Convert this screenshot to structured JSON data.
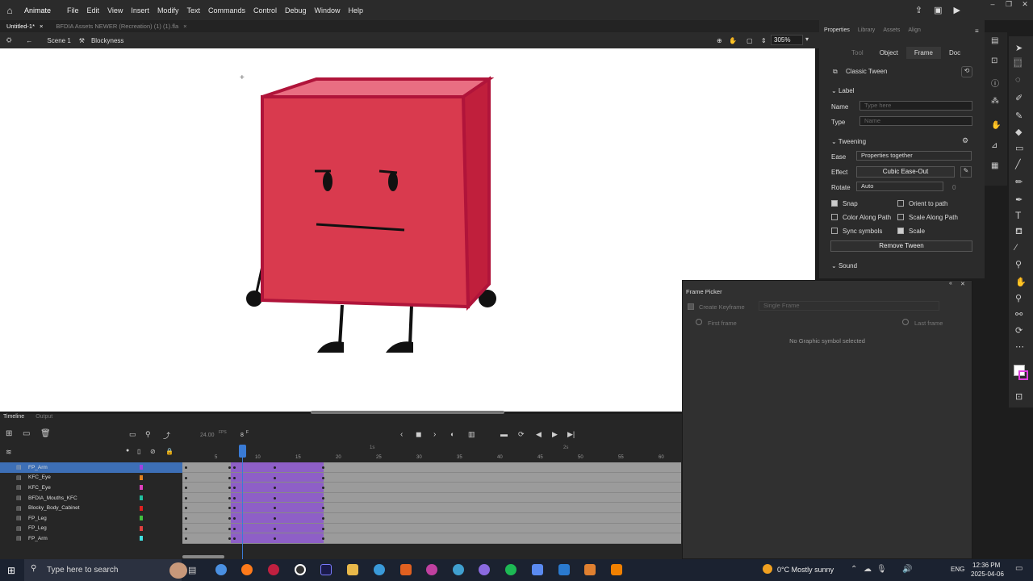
{
  "menubar": {
    "app": "Animate",
    "items": [
      "File",
      "Edit",
      "View",
      "Insert",
      "Modify",
      "Text",
      "Commands",
      "Control",
      "Debug",
      "Window",
      "Help"
    ]
  },
  "tabs": [
    {
      "label": "Untitled-1*",
      "active": true
    },
    {
      "label": "BFDIA Assets NEWER (Recreation) (1) (1).fla",
      "active": false
    }
  ],
  "scenebar": {
    "scene": "Scene 1",
    "symbol": "Blockyness",
    "zoom": "305%"
  },
  "timeline": {
    "tabs": [
      "Timeline",
      "Output"
    ],
    "fps": "24.00",
    "fps_unit": "FPS",
    "current_frame": "8",
    "frame_suffix": "F",
    "ruler": [
      "5",
      "10",
      "15",
      "20",
      "25",
      "30",
      "35",
      "40",
      "45",
      "50",
      "55",
      "60"
    ],
    "second_markers": [
      "1s",
      "2s"
    ],
    "layers": [
      {
        "name": "FP_Arm",
        "color": "#a040e0",
        "selected": true
      },
      {
        "name": "KFC_Eye",
        "color": "#e08020"
      },
      {
        "name": "KFC_Eye",
        "color": "#e040c0"
      },
      {
        "name": "BFDIA_Mouths_KFC",
        "color": "#20c0a0"
      },
      {
        "name": "Blocky_Body_Cabinet",
        "color": "#e02020"
      },
      {
        "name": "FP_Leg",
        "color": "#40c040"
      },
      {
        "name": "FP_Leg",
        "color": "#e04040"
      },
      {
        "name": "FP_Arm",
        "color": "#40e0e0"
      }
    ]
  },
  "properties": {
    "tabs": [
      "Properties",
      "Library",
      "Assets",
      "Align"
    ],
    "subtabs": [
      "Tool",
      "Object",
      "Frame",
      "Doc"
    ],
    "tween_type": "Classic Tween",
    "label_section": "Label",
    "name_label": "Name",
    "name_placeholder": "Type here",
    "type_label": "Type",
    "type_value": "Name",
    "tweening_section": "Tweening",
    "ease_label": "Ease",
    "ease_value": "Properties together",
    "effect_label": "Effect",
    "effect_value": "Cubic Ease-Out",
    "rotate_label": "Rotate",
    "rotate_value": "Auto",
    "rotate_count": "0",
    "snap": "Snap",
    "orient": "Orient to path",
    "color_path": "Color Along Path",
    "scale_path": "Scale Along Path",
    "sync": "Sync symbols",
    "scale": "Scale",
    "remove_tween": "Remove Tween",
    "sound_section": "Sound"
  },
  "picker": {
    "title": "Frame Picker",
    "create_keyframe": "Create Keyframe",
    "mode": "Single Frame",
    "first_frame": "First frame",
    "last_frame": "Last frame",
    "empty_msg": "No Graphic symbol selected"
  },
  "taskbar": {
    "search_placeholder": "Type here to search",
    "weather": "0°C  Mostly sunny",
    "lang": "ENG",
    "time": "12:36 PM",
    "date": "2025-04-06"
  },
  "colors": {
    "cube_front": "#d93a4e",
    "cube_top": "#e96e82",
    "cube_side": "#c01f3c",
    "cube_outline": "#b0143a",
    "tween": "#8e5fc7",
    "playhead": "#3a7bd5"
  }
}
